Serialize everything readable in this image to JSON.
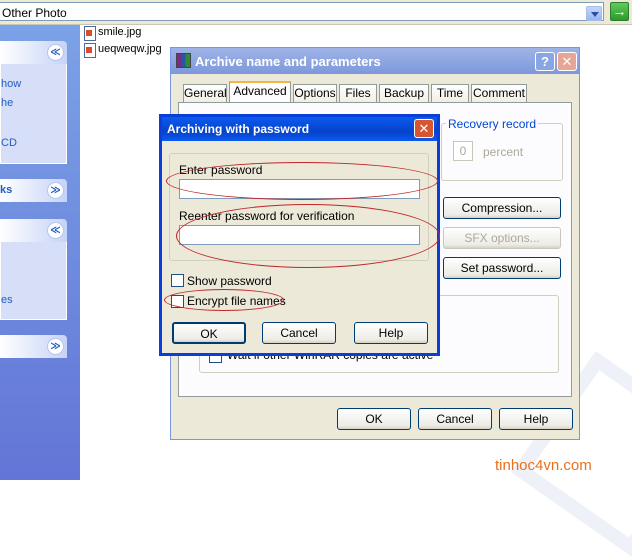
{
  "address_bar": {
    "text": "Other Photo",
    "go_label": "→"
  },
  "task_pane": {
    "sections": [
      {
        "title": "",
        "chevron": "≪",
        "links": [
          "how",
          "he",
          "CD"
        ]
      },
      {
        "title": "ks",
        "chevron": "≫",
        "links": []
      },
      {
        "title": "",
        "chevron": "≪",
        "links": [
          "es"
        ]
      },
      {
        "title": "",
        "chevron": "≫",
        "links": []
      }
    ]
  },
  "files": [
    {
      "name": "smile.jpg",
      "icon": "jpg-file-icon"
    },
    {
      "name": "ueqweqw.jpg",
      "icon": "jpg-file-icon"
    }
  ],
  "archive_dialog": {
    "title": "Archive name and parameters",
    "help_button": "?",
    "close_button": "✕",
    "tabs": [
      "General",
      "Advanced",
      "Options",
      "Files",
      "Backup",
      "Time",
      "Comment"
    ],
    "active_tab": "Advanced",
    "recovery_record_label": "Recovery record",
    "recovery_value": "0",
    "recovery_unit": "percent",
    "buttons": {
      "compression": "Compression...",
      "sfx": "SFX options...",
      "set_password": "Set password..."
    },
    "obscured_option": "Wait if other WinRAR copies are active",
    "footer": {
      "ok": "OK",
      "cancel": "Cancel",
      "help": "Help"
    }
  },
  "password_dialog": {
    "title": "Archiving with password",
    "close_button": "✕",
    "enter_label": "Enter password",
    "reenter_label": "Reenter password for verification",
    "enter_value": "",
    "reenter_value": "",
    "show_password_label": "Show password",
    "show_password_checked": false,
    "encrypt_names_label": "Encrypt file names",
    "encrypt_names_checked": false,
    "ok": "OK",
    "cancel": "Cancel",
    "help": "Help"
  },
  "watermark": "tinhoc4vn.com",
  "colors": {
    "annotation": "#c0262a",
    "watermark": "#e8701e",
    "title_active": "#0a5bf0"
  }
}
